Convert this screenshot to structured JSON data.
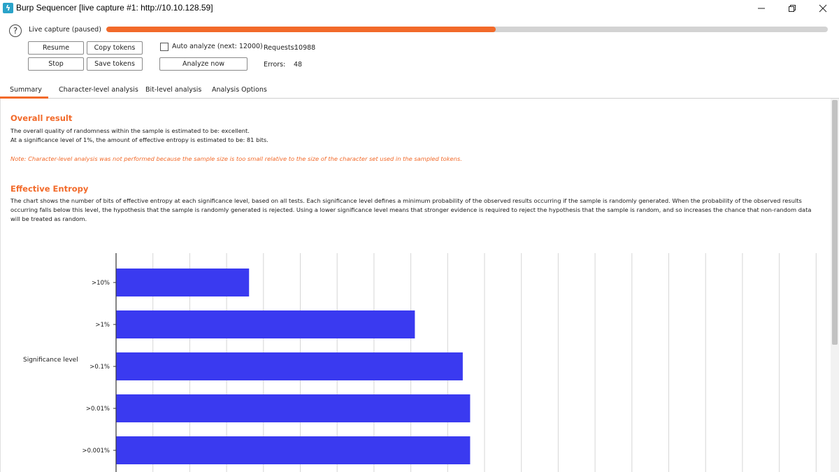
{
  "window": {
    "title": "Burp Sequencer [live capture #1: http://10.10.128.59]"
  },
  "capture": {
    "status": "Live capture (paused)",
    "progress": 0.54
  },
  "buttons": {
    "resume": "Resume",
    "copy_tokens": "Copy tokens",
    "stop": "Stop",
    "save_tokens": "Save tokens",
    "analyze_now": "Analyze now"
  },
  "auto_analyze": {
    "label": "Auto analyze (next: 12000)",
    "checked": false
  },
  "stats": {
    "requests_label": "Requests:",
    "requests_value": "10988",
    "errors_label": "Errors:",
    "errors_value": "48"
  },
  "tabs": [
    {
      "label": "Summary",
      "active": true
    },
    {
      "label": "Character-level analysis",
      "active": false
    },
    {
      "label": "Bit-level analysis",
      "active": false
    },
    {
      "label": "Analysis Options",
      "active": false
    }
  ],
  "summary": {
    "overall_heading": "Overall result",
    "overall_line1": "The overall quality of randomness within the sample is estimated to be: excellent.",
    "overall_line2": "At a significance level of 1%, the amount of effective entropy is estimated to be: 81 bits.",
    "note": "Note: Character-level analysis was not performed because the sample size is too small relative to the size of the character set used in the sampled tokens.",
    "entropy_heading": "Effective Entropy",
    "entropy_desc": "The chart shows the number of bits of effective entropy at each significance level, based on all tests. Each significance level defines a minimum probability of the observed results occurring if the sample is randomly generated. When the probability of the observed results occurring falls below this level, the hypothesis that the sample is randomly generated is rejected. Using a lower significance level means that stronger evidence is required to reject the hypothesis that the sample is random, and so increases the chance that non-random data will be treated as random."
  },
  "colors": {
    "accent": "#f26a2a",
    "bar": "#3a3af0"
  },
  "chart_data": {
    "type": "bar",
    "orientation": "horizontal",
    "ylabel": "Significance level",
    "categories": [
      ">10%",
      ">1%",
      ">0.1%",
      ">0.01%",
      ">0.001%"
    ],
    "values": [
      36,
      81,
      94,
      96,
      96
    ],
    "xlim": [
      0,
      200
    ],
    "grid": true
  }
}
